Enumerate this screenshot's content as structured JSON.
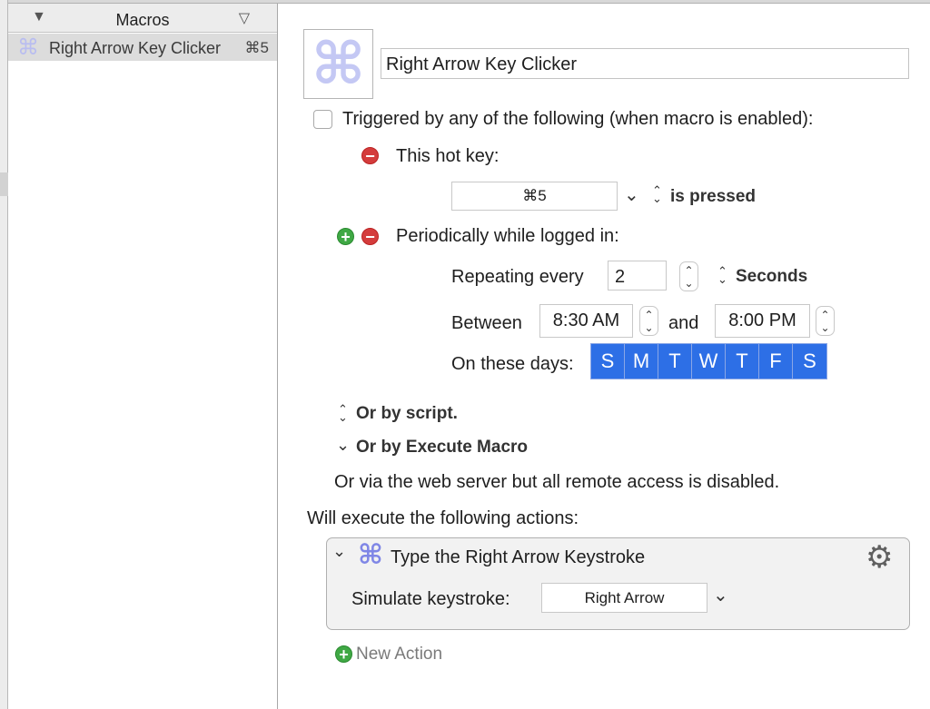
{
  "colors": {
    "accent": "#2d6fe6",
    "remove": "#d43c3c",
    "add": "#3fa844",
    "icon_tint": "#c4c8f4"
  },
  "macro_list": {
    "header": "Macros",
    "sort_icon_left": "▼",
    "sort_icon_right": "▽",
    "items": [
      {
        "icon": "command-icon",
        "icon_glyph": "⌘",
        "label": "Right Arrow Key Clicker",
        "hotkey": "⌘5"
      }
    ]
  },
  "editor": {
    "macro_icon": "⌘",
    "macro_name": "Right Arrow Key Clicker",
    "triggers": {
      "enabled_label": "Triggered by any of the following (when macro is enabled):",
      "hotkey": {
        "label": "This hot key:",
        "value": "⌘5",
        "dropdown": "⌄",
        "condition_icon": "⌃⌄",
        "condition": "is pressed"
      },
      "periodic": {
        "label": "Periodically while logged in:",
        "repeating_label": "Repeating every",
        "repeating_value": "2",
        "unit": "Seconds",
        "between_label": "Between",
        "start_time": "8:30 AM",
        "and_label": "and",
        "end_time": "8:00 PM",
        "days_label": "On these days:",
        "days": [
          "S",
          "M",
          "T",
          "W",
          "T",
          "F",
          "S"
        ]
      },
      "or_script": "Or by script.",
      "or_execute": "Or by Execute Macro",
      "web_server_note": "Or via the web server but all remote access is disabled."
    },
    "actions": {
      "heading": "Will execute the following actions:",
      "items": [
        {
          "icon": "command-icon",
          "icon_glyph": "⌘",
          "title": "Type the Right Arrow Keystroke",
          "field_label": "Simulate keystroke:",
          "keystroke": "Right Arrow"
        }
      ],
      "new_action": "New Action"
    }
  }
}
